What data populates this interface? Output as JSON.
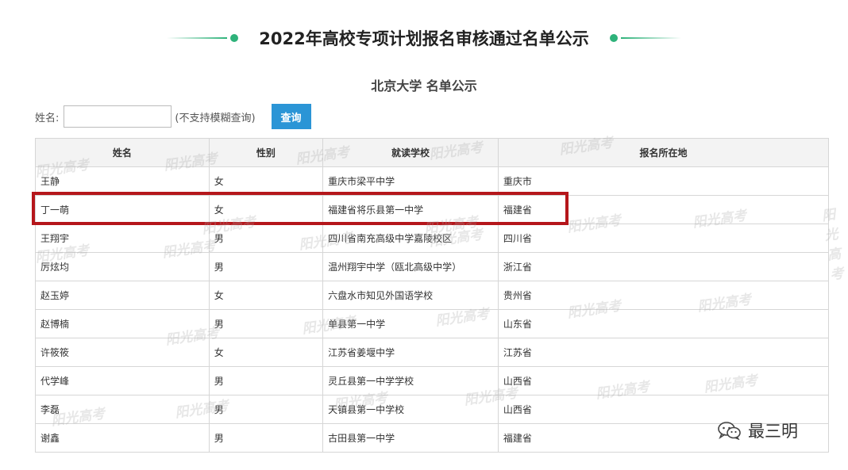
{
  "page_title": "2022年高校专项计划报名审核通过名单公示",
  "subtitle": "北京大学 名单公示",
  "search": {
    "label": "姓名:",
    "value": "",
    "placeholder": "",
    "hint": "(不支持模糊查询)",
    "button_label": "查询"
  },
  "table": {
    "headers": [
      "姓名",
      "性别",
      "就读学校",
      "报名所在地"
    ],
    "rows": [
      [
        "王静",
        "女",
        "重庆市梁平中学",
        "重庆市"
      ],
      [
        "丁一萌",
        "女",
        "福建省将乐县第一中学",
        "福建省"
      ],
      [
        "王翔宇",
        "男",
        "四川省南充高级中学嘉陵校区",
        "四川省"
      ],
      [
        "厉炫均",
        "男",
        "温州翔宇中学（瓯北高级中学）",
        "浙江省"
      ],
      [
        "赵玉婷",
        "女",
        "六盘水市知见外国语学校",
        "贵州省"
      ],
      [
        "赵博楠",
        "男",
        "单县第一中学",
        "山东省"
      ],
      [
        "许筱筱",
        "女",
        "江苏省姜堰中学",
        "江苏省"
      ],
      [
        "代学峰",
        "男",
        "灵丘县第一中学学校",
        "山西省"
      ],
      [
        "李磊",
        "男",
        "天镇县第一中学校",
        "山西省"
      ],
      [
        "谢鑫",
        "男",
        "古田县第一中学",
        "福建省"
      ]
    ]
  },
  "watermark_text": "阳光高考",
  "brand": {
    "name": "最三明",
    "icon": "wechat-icon"
  },
  "colors": {
    "accent_green": "#2eb27a",
    "button_blue": "#2b95d6",
    "highlight_red": "#b5161b"
  }
}
